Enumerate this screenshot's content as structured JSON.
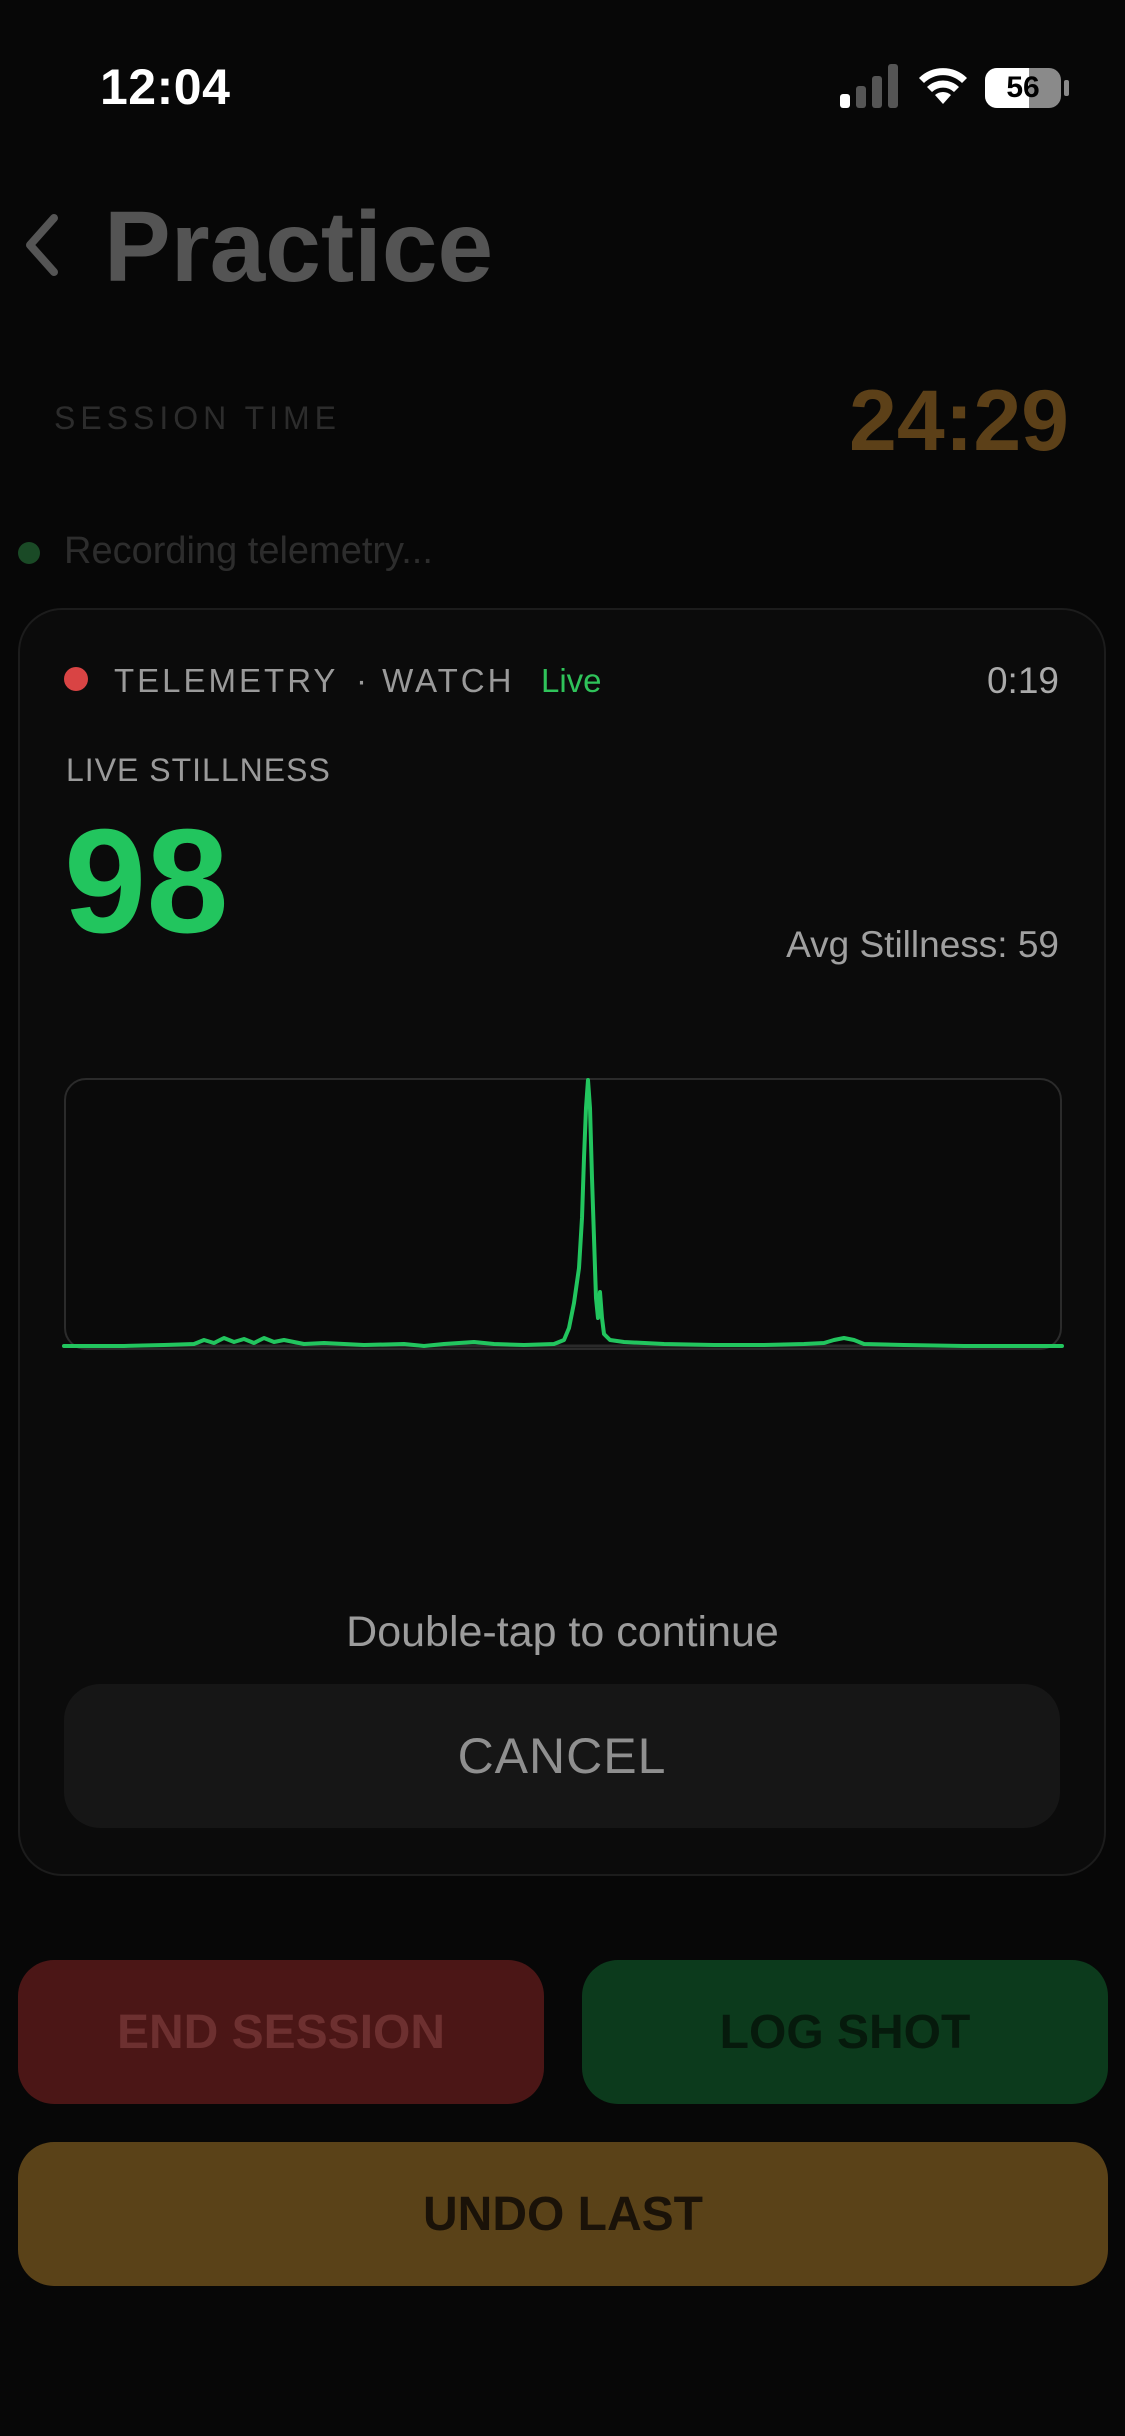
{
  "status_bar": {
    "time": "12:04",
    "battery": "56"
  },
  "header": {
    "title": "Practice"
  },
  "session": {
    "label": "SESSION TIME",
    "time": "24:29",
    "recording_text": "Recording telemetry..."
  },
  "telemetry": {
    "title": "TELEMETRY",
    "source": "· WATCH",
    "live_label": "Live",
    "elapsed": "0:19",
    "stillness_label": "LIVE STILLNESS",
    "stillness_value": "98",
    "avg_stillness": "Avg Stillness: 59",
    "hint": "Double-tap to continue",
    "cancel_label": "CANCEL"
  },
  "actions": {
    "end_session": "END SESSION",
    "log_shot": "LOG SHOT",
    "undo_last": "UNDO LAST"
  },
  "colors": {
    "accent_green": "#22c55e",
    "live_red": "#d94444",
    "timer_gold": "#5c4018"
  }
}
